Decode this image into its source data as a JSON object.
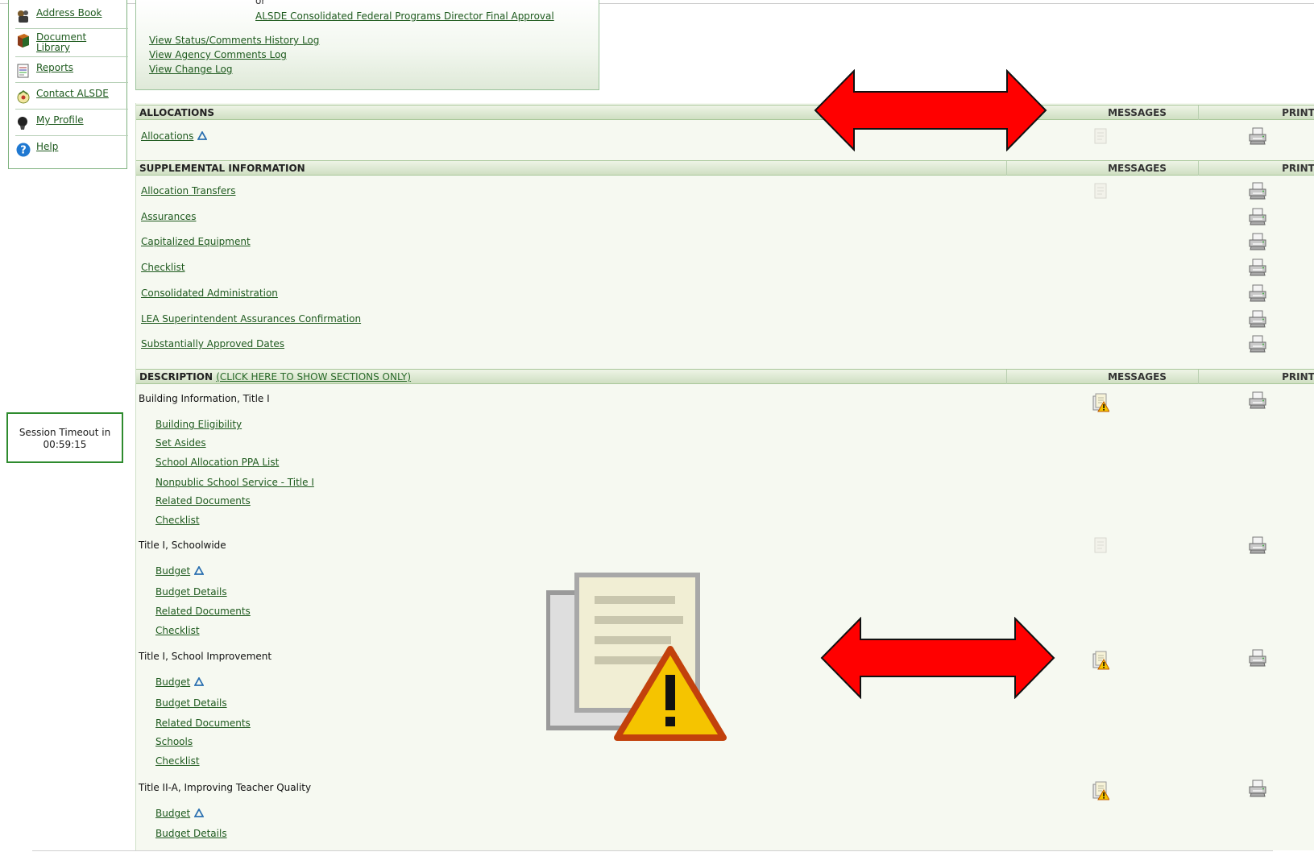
{
  "nav": {
    "items": [
      {
        "label": "Address Book",
        "icon": "address-book-icon"
      },
      {
        "label": "Document Library",
        "icon": "document-library-icon"
      },
      {
        "label": "Reports",
        "icon": "reports-icon"
      },
      {
        "label": "Contact ALSDE",
        "icon": "contact-icon"
      },
      {
        "label": "My Profile",
        "icon": "profile-icon"
      },
      {
        "label": "Help",
        "icon": "help-icon"
      }
    ]
  },
  "session": {
    "label": "Session Timeout in",
    "time": "00:59:15"
  },
  "approvals": {
    "partial_text": "or",
    "final_approval": "ALSDE Consolidated Federal Programs Director Final Approval",
    "links": [
      "View Status/Comments History Log",
      "View Agency Comments Log",
      "View Change Log"
    ]
  },
  "headers": {
    "messages": "MESSAGES",
    "print": "PRINT"
  },
  "sections": {
    "allocations": {
      "title": "ALLOCATIONS",
      "items": [
        "Allocations"
      ]
    },
    "supplemental": {
      "title": "SUPPLEMENTAL INFORMATION",
      "items": [
        "Allocation Transfers",
        "Assurances",
        "Capitalized Equipment",
        "Checklist",
        "Consolidated Administration",
        "LEA Superintendent Assurances Confirmation",
        "Substantially Approved Dates"
      ]
    },
    "description": {
      "title": "DESCRIPTION",
      "subtitle": "(CLICK HERE TO SHOW SECTIONS ONLY)",
      "groups": [
        {
          "name": "Building Information, Title I",
          "items": [
            "Building Eligibility",
            "Set Asides",
            "School Allocation PPA List",
            "Nonpublic School Service - Title I",
            "Related Documents",
            "Checklist"
          ]
        },
        {
          "name": "Title I, Schoolwide",
          "items": [
            "Budget",
            "Budget Details",
            "Related Documents",
            "Checklist"
          ]
        },
        {
          "name": "Title I, School Improvement",
          "items": [
            "Budget",
            "Budget Details",
            "Related Documents",
            "Schools",
            "Checklist"
          ]
        },
        {
          "name": "Title II-A, Improving Teacher Quality",
          "items": [
            "Budget",
            "Budget Details"
          ]
        }
      ]
    }
  },
  "colors": {
    "accent_green": "#2e8b2e",
    "link": "#1e5a1e",
    "arrow_red": "#ff0000",
    "panel": "#f6f9f1"
  }
}
